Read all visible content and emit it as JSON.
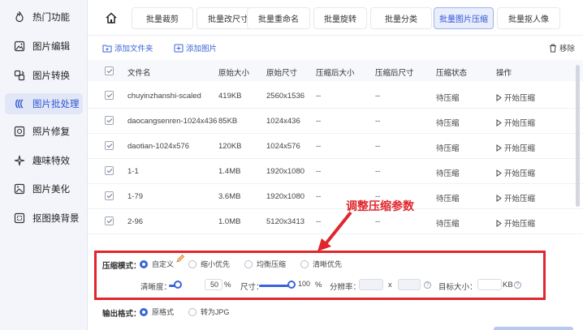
{
  "sidebar": {
    "items": [
      {
        "label": "热门功能",
        "icon": "flame-icon"
      },
      {
        "label": "图片编辑",
        "icon": "image-edit-icon"
      },
      {
        "label": "图片转换",
        "icon": "convert-icon"
      },
      {
        "label": "图片批处理",
        "icon": "batch-icon"
      },
      {
        "label": "照片修复",
        "icon": "photo-repair-icon"
      },
      {
        "label": "趣味特效",
        "icon": "sparkle-icon"
      },
      {
        "label": "图片美化",
        "icon": "beautify-icon"
      },
      {
        "label": "抠图换背景",
        "icon": "cutout-icon"
      }
    ],
    "active_index": 3
  },
  "tabs": [
    "批量裁剪",
    "批量改尺寸",
    "批量重命名",
    "批量旋转",
    "批量分类",
    "批量图片压缩",
    "批量抠人像"
  ],
  "active_tab": 5,
  "actions": {
    "add_folder": "添加文件夹",
    "add_image": "添加图片",
    "remove": "移除"
  },
  "table": {
    "headers": [
      "文件名",
      "原始大小",
      "原始尺寸",
      "压缩后大小",
      "压缩后尺寸",
      "压缩状态",
      "操作"
    ],
    "rows": [
      {
        "name": "chuyinzhanshi-scaled",
        "size": "419KB",
        "dims": "2560x1536",
        "csize": "--",
        "cdims": "--",
        "status": "待压缩",
        "action": "开始压缩"
      },
      {
        "name": "daocangsenren-1024x436",
        "size": "85KB",
        "dims": "1024x436",
        "csize": "--",
        "cdims": "--",
        "status": "待压缩",
        "action": "开始压缩"
      },
      {
        "name": "daotian-1024x576",
        "size": "120KB",
        "dims": "1024x576",
        "csize": "--",
        "cdims": "--",
        "status": "待压缩",
        "action": "开始压缩"
      },
      {
        "name": "1-1",
        "size": "1.4MB",
        "dims": "1920x1080",
        "csize": "--",
        "cdims": "--",
        "status": "待压缩",
        "action": "开始压缩"
      },
      {
        "name": "1-79",
        "size": "3.6MB",
        "dims": "1920x1080",
        "csize": "--",
        "cdims": "--",
        "status": "待压缩",
        "action": "开始压缩"
      },
      {
        "name": "2-96",
        "size": "1.0MB",
        "dims": "5120x3413",
        "csize": "--",
        "cdims": "--",
        "status": "待压缩",
        "action": "开始压缩"
      }
    ]
  },
  "annotation": "调整压缩参数",
  "settings": {
    "mode_label": "压缩模式：",
    "modes": [
      "自定义",
      "缩小优先",
      "均衡压缩",
      "清晰优先"
    ],
    "active_mode": 0,
    "clarity_label": "清晰度：",
    "clarity_value": "50",
    "clarity_unit": "%",
    "clarity_level": 0.5,
    "size_label": "尺寸：",
    "size_value": "100",
    "size_unit": "%",
    "size_level": 1.0,
    "resolution_label": "分辨率：",
    "resolution_x": "",
    "resolution_sep": "x",
    "resolution_y": "",
    "target_label": "目标大小：",
    "target_value": "",
    "target_unit": "KB",
    "help_mark": "?",
    "output_label": "输出格式：",
    "outputs": [
      "原格式",
      "转为JPG"
    ],
    "active_output": 0
  },
  "colors": {
    "accent": "#3a63d8",
    "annotation": "#e0262c"
  }
}
